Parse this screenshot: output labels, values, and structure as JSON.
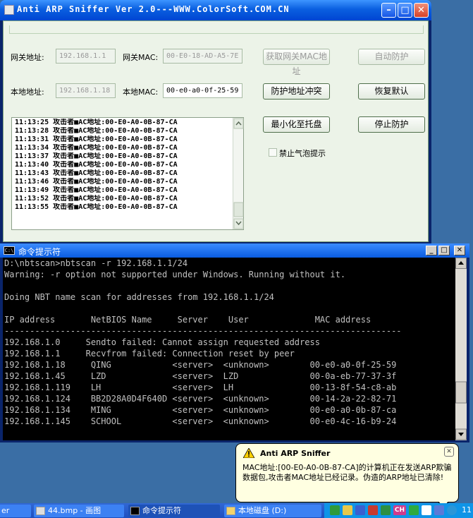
{
  "app": {
    "title": "Anti ARP Sniffer Ver 2.0---WWW.ColorSoft.COM.CN",
    "gateway_ip_label": "网关地址:",
    "gateway_ip": "192.168.1.1",
    "gateway_mac_label": "网关MAC:",
    "gateway_mac": "00-E0-18-AD-A5-7E",
    "local_ip_label": "本地地址:",
    "local_ip": "192.168.1.18",
    "local_mac_label": "本地MAC:",
    "local_mac": "00-e0-a0-0f-25-59",
    "buttons": {
      "get_gateway_mac": "获取网关MAC地址",
      "auto_protect": "自动防护",
      "prevent_conflict": "防护地址冲突",
      "restore_default": "恢复默认",
      "minimize_tray": "最小化至托盘",
      "stop_protect": "停止防护"
    },
    "disable_balloon_label": "禁止气泡提示",
    "log": [
      "11:13:25 攻击者■AC地址:00-E0-A0-0B-87-CA",
      "11:13:28 攻击者■AC地址:00-E0-A0-0B-87-CA",
      "11:13:31 攻击者■AC地址:00-E0-A0-0B-87-CA",
      "11:13:34 攻击者■AC地址:00-E0-A0-0B-87-CA",
      "11:13:37 攻击者■AC地址:00-E0-A0-0B-87-CA",
      "11:13:40 攻击者■AC地址:00-E0-A0-0B-87-CA",
      "11:13:43 攻击者■AC地址:00-E0-A0-0B-87-CA",
      "11:13:46 攻击者■AC地址:00-E0-A0-0B-87-CA",
      "11:13:49 攻击者■AC地址:00-E0-A0-0B-87-CA",
      "11:13:52 攻击者■AC地址:00-E0-A0-0B-87-CA",
      "11:13:55 攻击者■AC地址:00-E0-A0-0B-87-CA"
    ]
  },
  "cmd": {
    "title": "命令提示符",
    "icon_text": "C:\\",
    "lines": [
      "D:\\nbtscan>nbtscan -r 192.168.1.1/24",
      "Warning: -r option not supported under Windows. Running without it.",
      "",
      "Doing NBT name scan for addresses from 192.168.1.1/24",
      "",
      "IP address       NetBIOS Name     Server    User             MAC address",
      "------------------------------------------------------------------------------",
      "192.168.1.0     Sendto failed: Cannot assign requested address",
      "192.168.1.1     Recvfrom failed: Connection reset by peer",
      "192.168.1.18     QING            <server>  <unknown>        00-e0-a0-0f-25-59",
      "192.168.1.45     LZD             <server>  LZD              00-0a-eb-77-37-3f",
      "192.168.1.119    LH              <server>  LH               00-13-8f-54-c8-ab",
      "192.168.1.124    BB2D28A0D4F640D <server>  <unknown>        00-14-2a-22-82-71",
      "192.168.1.134    MING            <server>  <unknown>        00-e0-a0-0b-87-ca",
      "192.168.1.145    SCHOOL          <server>  <unknown>        00-e0-4c-16-b9-24"
    ]
  },
  "balloon": {
    "title": "Anti ARP Sniffer",
    "message": "MAC地址:[00-E0-A0-0B-87-CA]的计算机正在发送ARP欺骗数据包,攻击者MAC地址已经记录。伪造的ARP地址已清除!"
  },
  "taskbar": {
    "items": [
      "er",
      "44.bmp - 画图",
      "命令提示符",
      "本地磁盘 (D:)"
    ],
    "clock": "11"
  },
  "colors": {
    "titlebar": "#0a5fe0",
    "client_bg": "#ecf3e8",
    "balloon_bg": "#ffffe1"
  }
}
